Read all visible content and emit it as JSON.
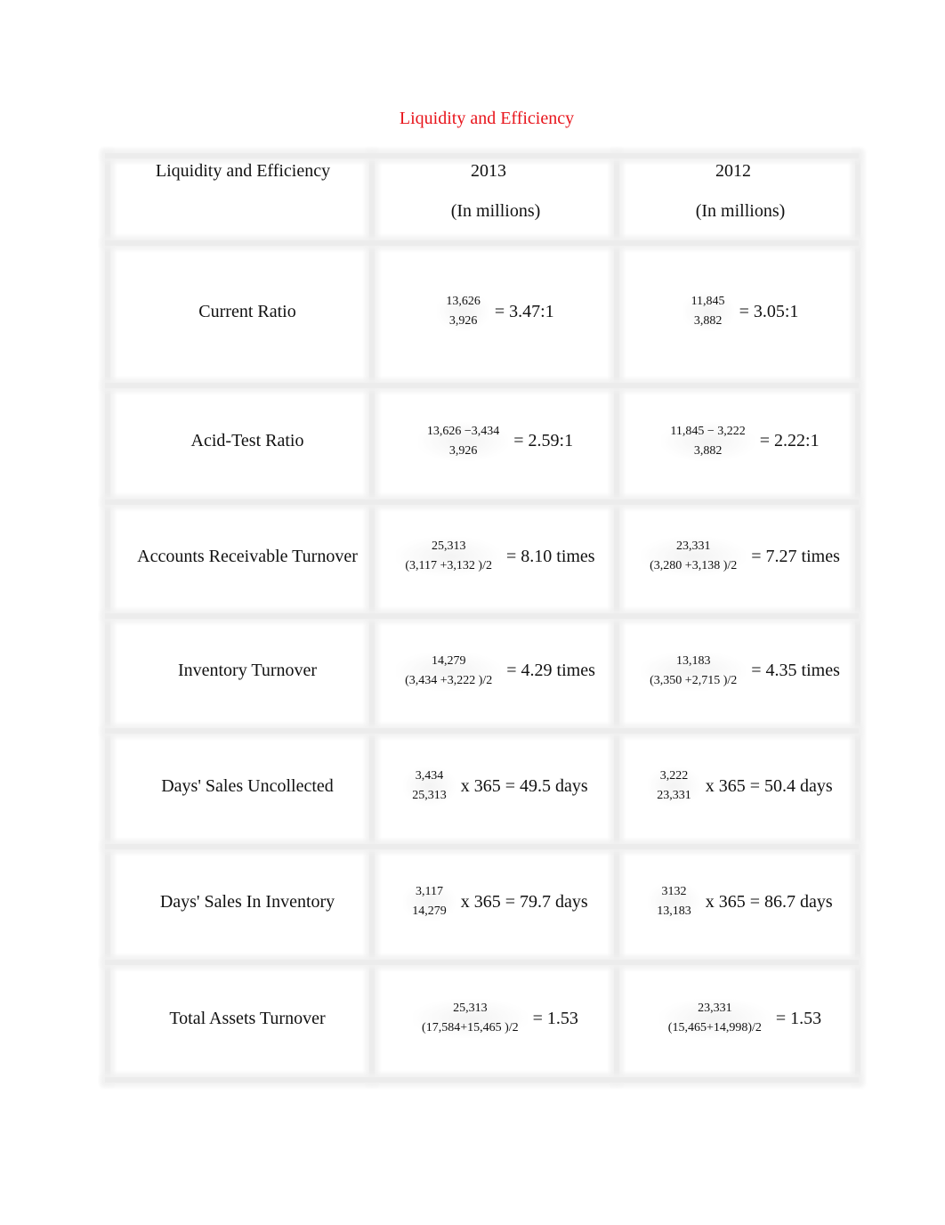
{
  "title": "Liquidity and Efficiency",
  "header": {
    "col1": "Liquidity and Efficiency",
    "col2_year": "2013",
    "col2_unit": "(In millions)",
    "col3_year": "2012",
    "col3_unit": "(In millions)"
  },
  "rows": [
    {
      "label": "Current Ratio",
      "y2013": {
        "num": "13,626",
        "den": "3,926",
        "result": "= 3.47:1"
      },
      "y2012": {
        "num": "11,845",
        "den": "3,882",
        "result": "= 3.05:1"
      }
    },
    {
      "label": "Acid-Test Ratio",
      "y2013": {
        "num": "13,626 −3,434",
        "den": "3,926",
        "result": "= 2.59:1"
      },
      "y2012": {
        "num": "11,845 − 3,222",
        "den": "3,882",
        "result": "= 2.22:1"
      }
    },
    {
      "label": "Accounts Receivable Turnover",
      "y2013": {
        "num": "25,313",
        "den": "(3,117 +3,132 )/2",
        "result": "= 8.10 times"
      },
      "y2012": {
        "num": "23,331",
        "den": "(3,280 +3,138 )/2",
        "result": "= 7.27 times"
      }
    },
    {
      "label": "Inventory Turnover",
      "y2013": {
        "num": "14,279",
        "den": "(3,434 +3,222 )/2",
        "result": "= 4.29 times"
      },
      "y2012": {
        "num": "13,183",
        "den": "(3,350 +2,715 )/2",
        "result": "= 4.35 times"
      }
    },
    {
      "label": "Days' Sales Uncollected",
      "y2013": {
        "num": "3,434",
        "den": "25,313",
        "result": "x 365 = 49.5 days"
      },
      "y2012": {
        "num": "3,222",
        "den": "23,331",
        "result": "x 365 = 50.4 days"
      }
    },
    {
      "label": "Days' Sales In Inventory",
      "y2013": {
        "num": "3,117",
        "den": "14,279",
        "result": "x 365 = 79.7 days"
      },
      "y2012": {
        "num": "3132",
        "den": "13,183",
        "result": "x 365 = 86.7 days"
      }
    },
    {
      "label": "Total Assets Turnover",
      "y2013": {
        "num": "25,313",
        "den": "(17,584+15,465 )/2",
        "result": "= 1.53"
      },
      "y2012": {
        "num": "23,331",
        "den": "(15,465+14,998)/2",
        "result": "= 1.53"
      }
    }
  ]
}
